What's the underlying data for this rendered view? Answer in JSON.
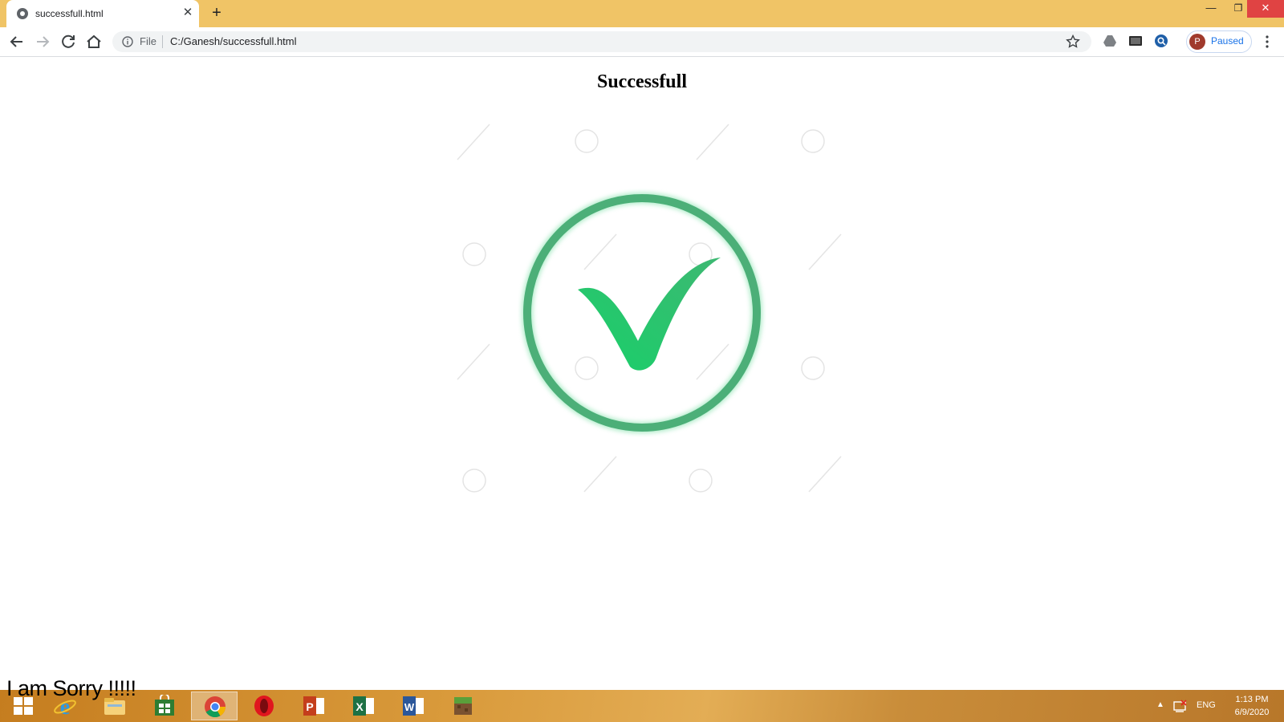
{
  "browser": {
    "tab_title": "successfull.html",
    "close_glyph": "✕",
    "new_tab_glyph": "+",
    "scheme_label": "File",
    "url": "C:/Ganesh/successfull.html",
    "profile_initial": "P",
    "profile_status": "Paused",
    "window_controls": {
      "minimize": "—",
      "maximize": "❐",
      "close": "✕"
    }
  },
  "page": {
    "heading": "Successfull",
    "icon": "success-checkmark-icon",
    "overlay_text": "I am Sorry !!!!!"
  },
  "taskbar": {
    "apps": [
      "start-icon",
      "internet-explorer-icon",
      "file-explorer-icon",
      "store-icon",
      "chrome-icon",
      "opera-icon",
      "powerpoint-icon",
      "excel-icon",
      "word-icon",
      "minecraft-icon"
    ],
    "active_app": "chrome-icon",
    "tray_arrow": "▲",
    "language": "ENG",
    "time": "1:13 PM",
    "date": "6/9/2020"
  },
  "colors": {
    "titlebar": "#f0c466",
    "ring": "#4caf78",
    "check": "#22c76b",
    "profile_avatar": "#a03a2c"
  }
}
